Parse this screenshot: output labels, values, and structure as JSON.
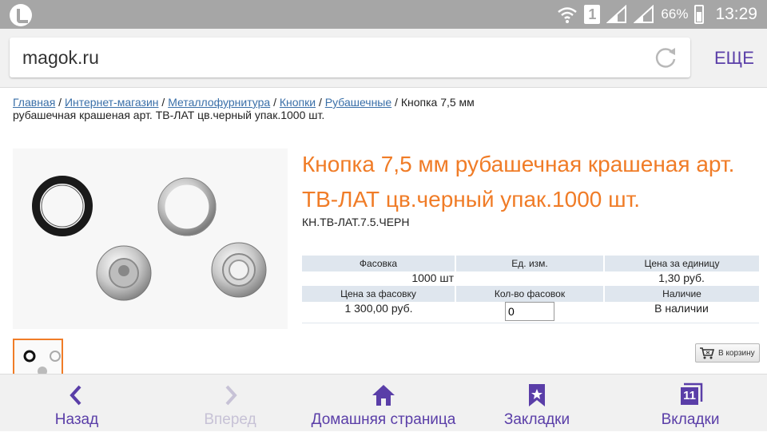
{
  "status_bar": {
    "sim_slot": "1",
    "battery": "66%",
    "time": "13:29"
  },
  "browser": {
    "url": "magok.ru",
    "more_label": "ЕЩЕ"
  },
  "breadcrumb": {
    "links": [
      "Главная",
      "Интернет-магазин",
      "Металлофурнитура",
      "Кнопки",
      "Рубашечные"
    ],
    "separator": " / ",
    "current": "Кнопка 7,5 мм рубашечная крашеная арт. ТВ-ЛАТ цв.черный упак.1000 шт."
  },
  "product": {
    "title": "Кнопка 7,5 мм рубашечная крашеная арт. ТВ-ЛАТ цв.черный упак.1000 шт.",
    "sku": "КН.ТВ-ЛАТ.7.5.ЧЕРН",
    "accent_color": "#f07c27"
  },
  "table": {
    "headers_row1": [
      "Фасовка",
      "Ед. изм.",
      "Цена за единицу"
    ],
    "values_row1": [
      "1000 шт",
      "",
      "1,30 руб."
    ],
    "headers_row2": [
      "Цена за фасовку",
      "Кол-во фасовок",
      "Наличие"
    ],
    "price_per_pack": "1 300,00 руб.",
    "quantity_value": "0",
    "availability": "В наличии"
  },
  "cart_button": {
    "label": "В корзину",
    "icon": "cart-icon"
  },
  "bottom_nav": {
    "back": "Назад",
    "forward": "Вперед",
    "home": "Домашняя страница",
    "bookmarks": "Закладки",
    "tabs": "Вкладки",
    "tabs_count": "11"
  },
  "colors": {
    "nav_accent": "#5a3ea8",
    "link": "#3a6fa8"
  }
}
